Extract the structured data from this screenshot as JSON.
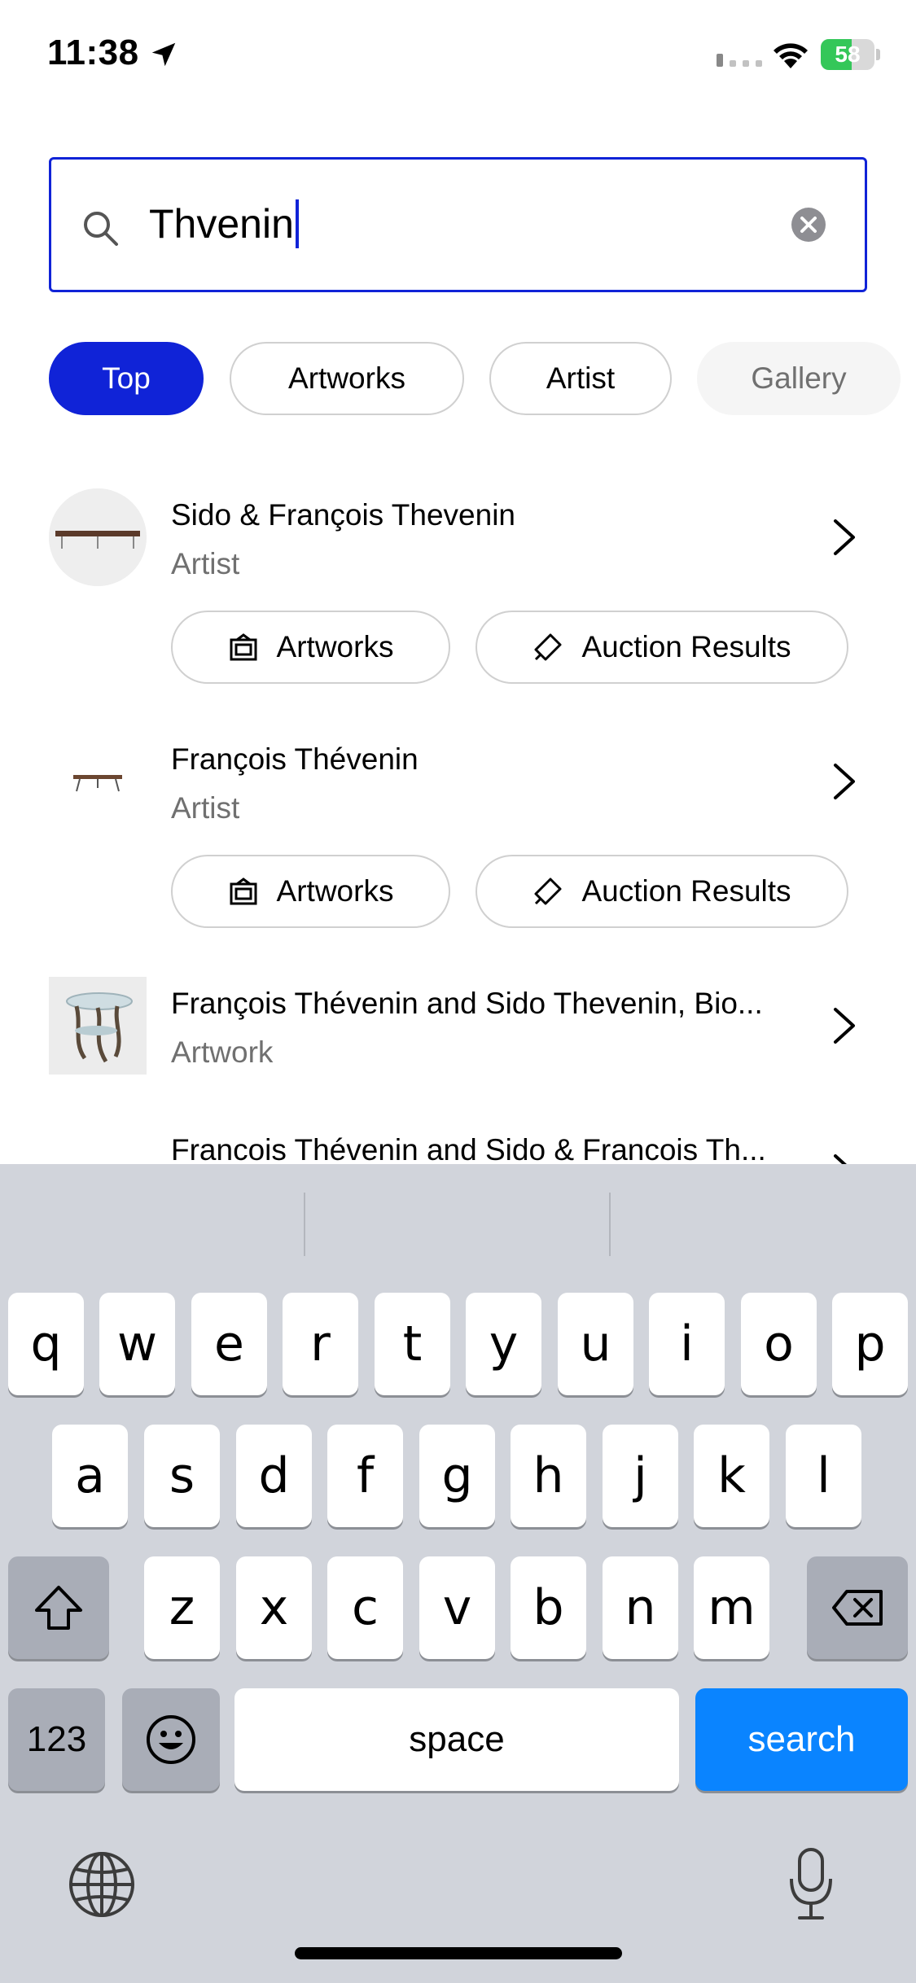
{
  "status_bar": {
    "time": "11:38",
    "battery_percent": "58",
    "battery_level": 0.58,
    "battery_color": "#34c759"
  },
  "search": {
    "value": "Thvenin",
    "accent_color": "#1023d7"
  },
  "filters": {
    "items": [
      {
        "label": "Top",
        "state": "active"
      },
      {
        "label": "Artworks",
        "state": "default"
      },
      {
        "label": "Artist",
        "state": "default"
      },
      {
        "label": "Gallery",
        "state": "dimmed"
      }
    ]
  },
  "results": [
    {
      "title": "Sido & François Thevenin",
      "subtitle": "Artist",
      "thumb_icon": "bench-thumbnail",
      "actions": [
        "Artworks",
        "Auction Results"
      ]
    },
    {
      "title": "François Thévenin",
      "subtitle": "Artist",
      "thumb_icon": "table-thumbnail",
      "actions": [
        "Artworks",
        "Auction Results"
      ]
    },
    {
      "title": "François Thévenin and Sido Thevenin, Bio...",
      "subtitle": "Artwork",
      "thumb_icon": "sculpture-table-thumbnail"
    },
    {
      "title": "Francois Thévenin and Sido & Francois Th...",
      "subtitle": ""
    }
  ],
  "keyboard": {
    "row1": [
      "q",
      "w",
      "e",
      "r",
      "t",
      "y",
      "u",
      "i",
      "o",
      "p"
    ],
    "row2": [
      "a",
      "s",
      "d",
      "f",
      "g",
      "h",
      "j",
      "k",
      "l"
    ],
    "row3": [
      "z",
      "x",
      "c",
      "v",
      "b",
      "n",
      "m"
    ],
    "numbers_label": "123",
    "space_label": "space",
    "search_label": "search",
    "search_key_color": "#0a84ff"
  }
}
